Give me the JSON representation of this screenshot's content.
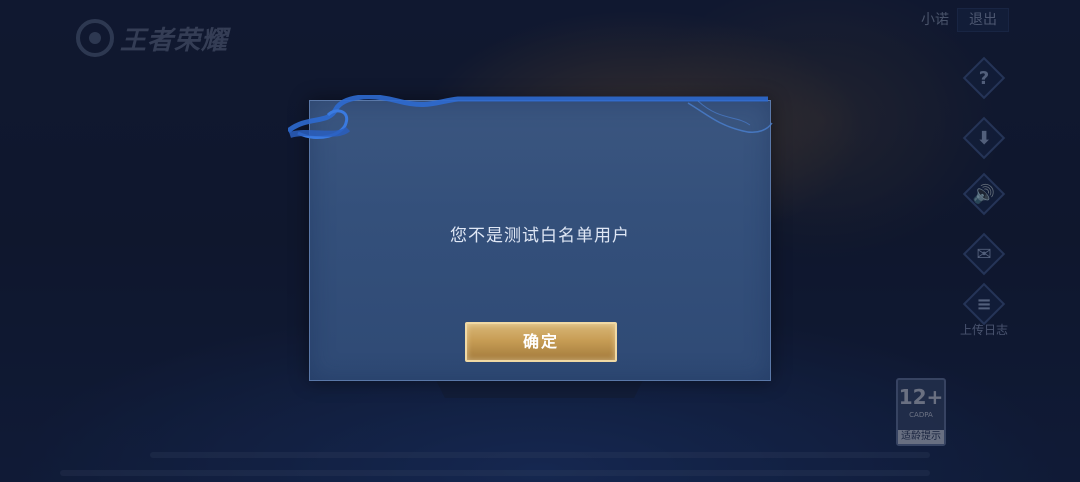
{
  "header": {
    "logo_text": "王者荣耀",
    "user_name": "小诺",
    "logout_label": "退出"
  },
  "side_buttons": [
    {
      "icon": "help-icon",
      "glyph": "?"
    },
    {
      "icon": "download-icon",
      "glyph": "⬇"
    },
    {
      "icon": "sound-icon",
      "glyph": "🔊"
    },
    {
      "icon": "notice-icon",
      "glyph": "✉"
    },
    {
      "icon": "log-icon",
      "glyph": "≡",
      "label": "上传日志"
    }
  ],
  "age_badge": {
    "rating": "12+",
    "org": "CADPA",
    "tip": "适龄提示"
  },
  "dialog": {
    "message": "您不是测试白名单用户",
    "confirm_label": "确定"
  },
  "colors": {
    "dialog_bg": "#34507b",
    "button_gold": "#c79d55",
    "text_light": "#dfe7f5"
  }
}
